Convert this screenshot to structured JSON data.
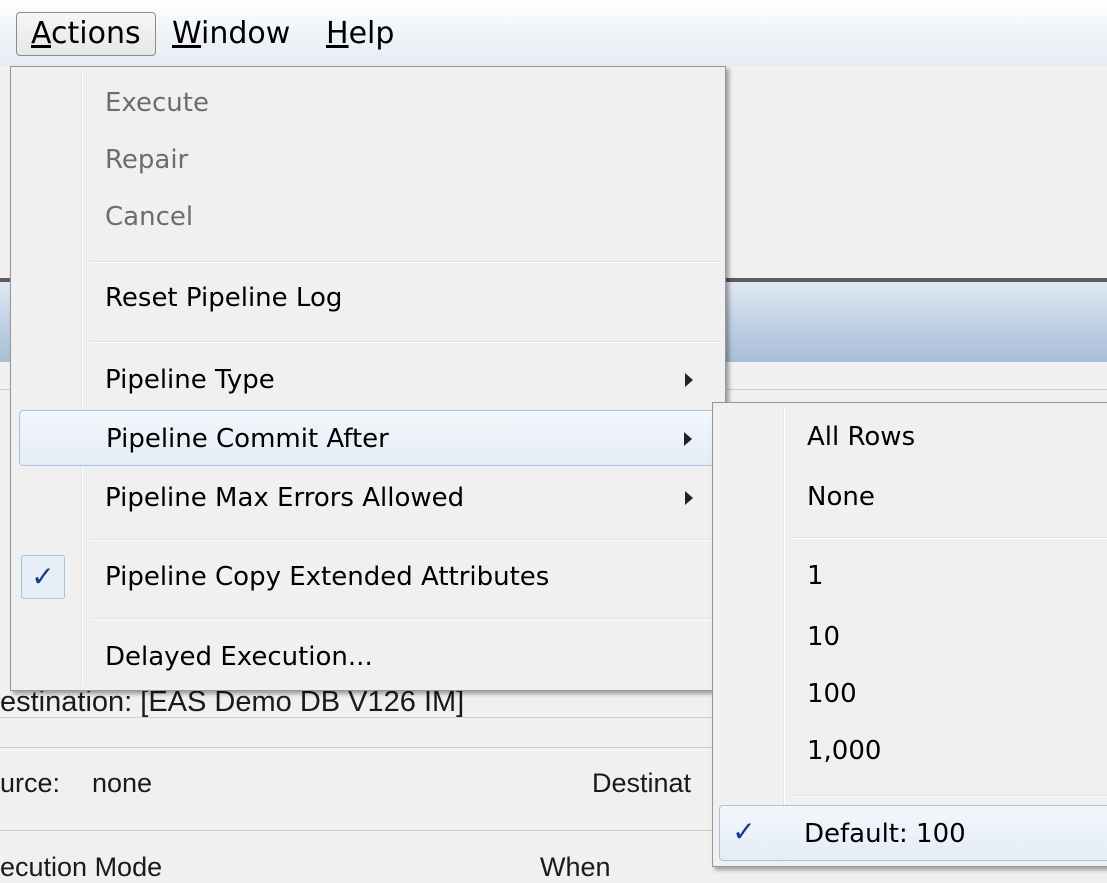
{
  "menubar": {
    "items": [
      {
        "label": "Actions",
        "mnemonic": "A",
        "rest": "ctions"
      },
      {
        "label": "Window",
        "mnemonic": "W",
        "rest": "indow"
      },
      {
        "label": "Help",
        "mnemonic": "H",
        "rest": "elp"
      }
    ]
  },
  "background": {
    "destination_title": "estination: [EAS Demo DB V126 IM]",
    "source_label": "urce:",
    "source_value": "none",
    "destination_label": "Destinat",
    "execution_mode_label": "ecution Mode",
    "when_label": "When"
  },
  "actions_menu": {
    "items": [
      {
        "label": "Execute",
        "enabled": false
      },
      {
        "label": "Repair",
        "enabled": false
      },
      {
        "label": "Cancel",
        "enabled": false
      },
      {
        "label": "Reset Pipeline Log",
        "enabled": true
      },
      {
        "label": "Pipeline Type",
        "enabled": true,
        "submenu": true
      },
      {
        "label": "Pipeline Commit After",
        "enabled": true,
        "submenu": true,
        "highlighted": true
      },
      {
        "label": "Pipeline Max Errors Allowed",
        "enabled": true,
        "submenu": true
      },
      {
        "label": "Pipeline Copy Extended Attributes",
        "enabled": true,
        "checked": true
      },
      {
        "label": "Delayed Execution...",
        "enabled": true
      }
    ]
  },
  "commit_after_submenu": {
    "items": [
      {
        "label": "All Rows"
      },
      {
        "label": "None"
      },
      {
        "label": "1"
      },
      {
        "label": "10"
      },
      {
        "label": "100"
      },
      {
        "label": "1,000"
      },
      {
        "label": "Default: 100",
        "checked": true,
        "highlighted": true
      }
    ]
  },
  "icons": {
    "check": "✓"
  },
  "colors": {
    "highlight_border": "#a8c1e0",
    "check_color": "#1b3a8c",
    "disabled_text": "#6d6d6d"
  }
}
